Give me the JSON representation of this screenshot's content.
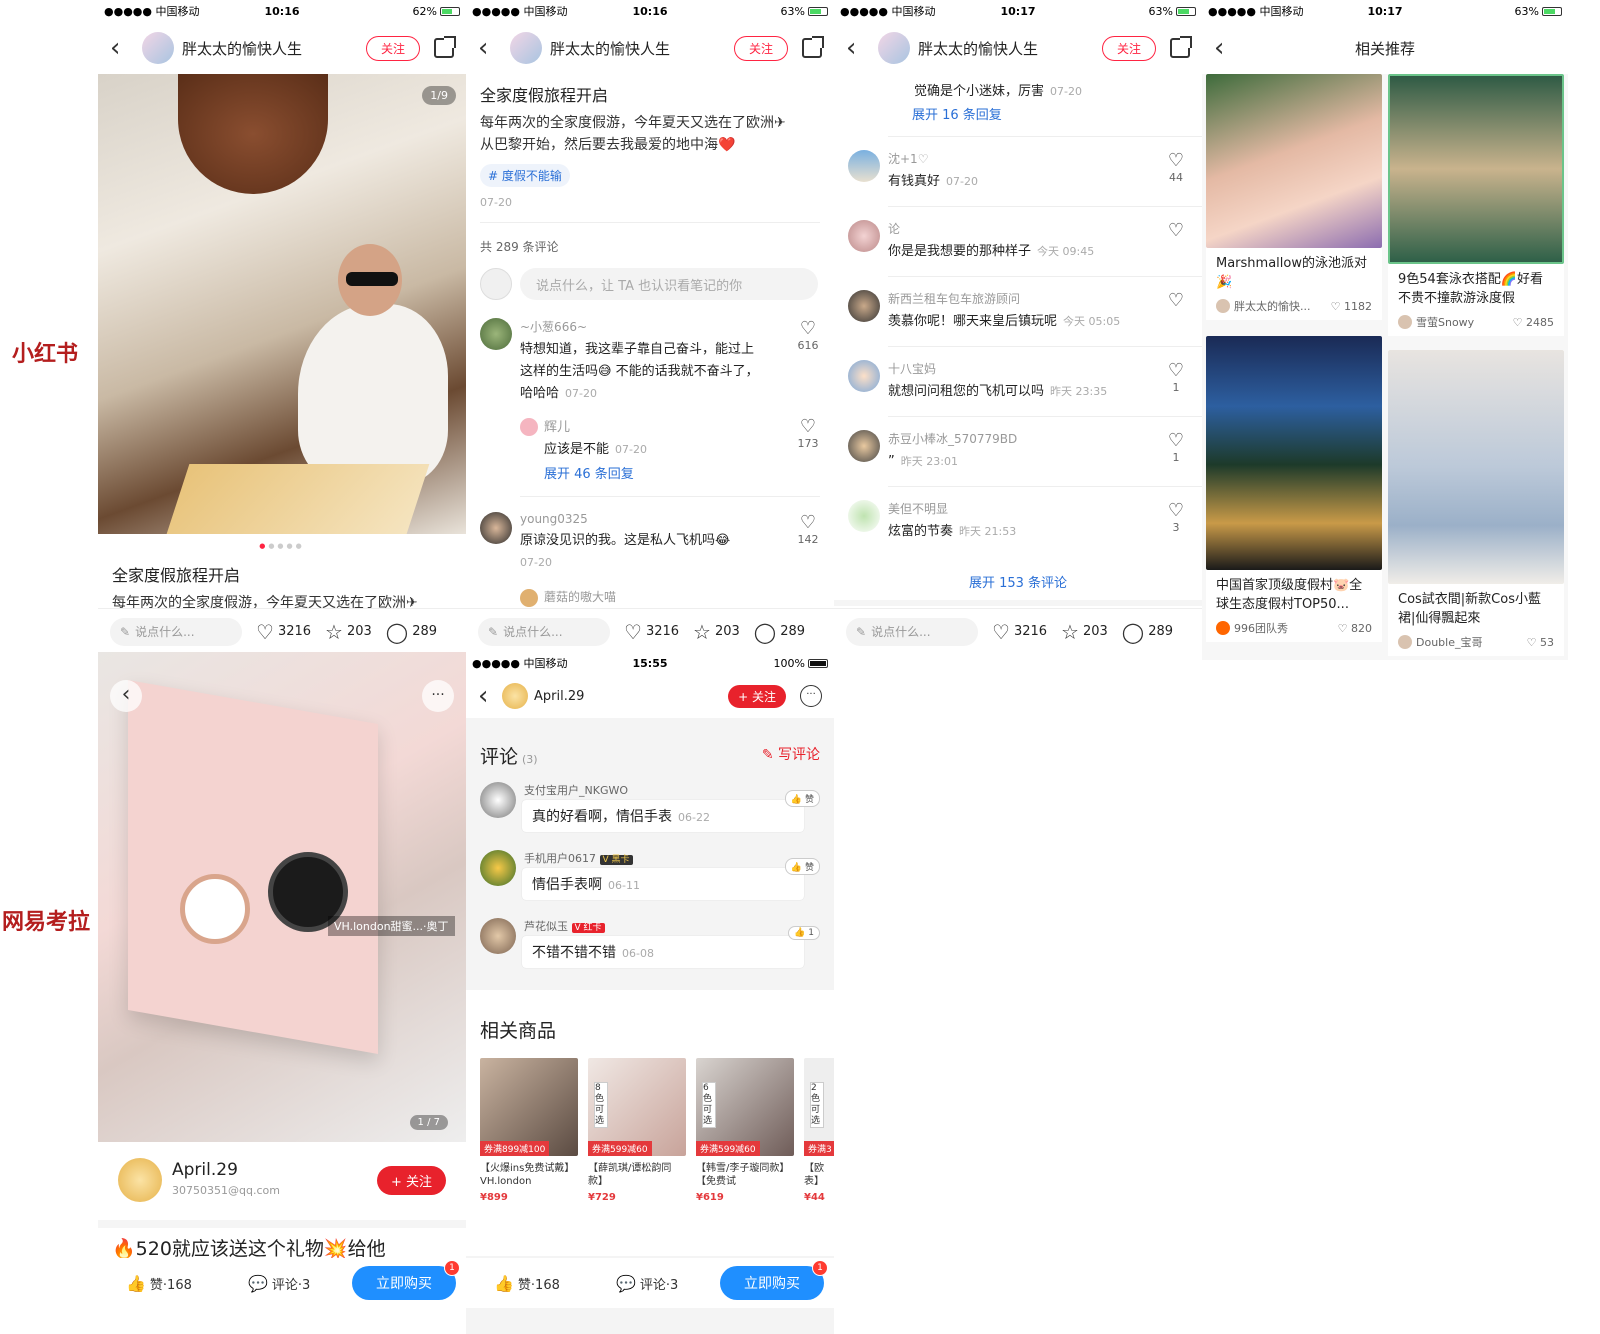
{
  "labels": {
    "xhs": "小红书",
    "kaola": "网易考拉"
  },
  "status": [
    {
      "carrier": "●●●●● 中国移动",
      "time": "10:16",
      "battery": "62%"
    },
    {
      "carrier": "●●●●● 中国移动",
      "time": "10:16",
      "battery": "63%"
    },
    {
      "carrier": "●●●●● 中国移动",
      "time": "10:17",
      "battery": "63%"
    },
    {
      "carrier": "●●●●● 中国移动",
      "time": "10:17",
      "battery": "63%"
    },
    {
      "carrier": "●●●●● 中国移动",
      "time": "15:55",
      "battery": "100%"
    }
  ],
  "xhs": {
    "author": "胖太太的愉快人生",
    "follow": "关注",
    "page_counter": "1/9",
    "title": "全家度假旅程开启",
    "desc": "每年两次的全家度假游，今年夏天又选在了欧洲✈",
    "desc2": "从巴黎开始，然后要去我最爱的地中海❤️",
    "tag": "# 度假不能输",
    "post_date": "07-20",
    "comment_total": "共 289 条评论",
    "comment_placeholder": "说点什么，让 TA 也认识看笔记的你",
    "bar": {
      "input": "说点什么...",
      "likes": "3216",
      "stars": "203",
      "comments": "289"
    },
    "comments_a": [
      {
        "name": "~小葱666~",
        "text": "特想知道，我这辈子靠自己奋斗，能过上",
        "text2": "这样的生活吗😅 不能的话我就不奋斗了，",
        "text3": "哈哈哈",
        "date": "07-20",
        "likes": "616"
      },
      {
        "name": "辉儿",
        "text": "应该是不能",
        "date": "07-20",
        "likes": "173",
        "expand": "展开 46 条回复"
      },
      {
        "name": "young0325",
        "text": "原谅没见识的我。这是私人飞机吗😂",
        "date": "07-20",
        "likes": "142"
      },
      {
        "name": "蘑菇的嗷大喵"
      }
    ],
    "comments_b": [
      {
        "text": "觉确是个小迷妹，厉害",
        "date": "07-20",
        "expand": "展开 16 条回复"
      },
      {
        "name": "沈+1♡",
        "text": "有钱真好",
        "date": "07-20",
        "likes": "44"
      },
      {
        "name": "论",
        "text": "你是是我想要的那种样子",
        "date": "今天 09:45",
        "likes": ""
      },
      {
        "name": "新西兰租车包车旅游顾问",
        "text": "羡慕你呢！哪天来皇后镇玩呢",
        "date": "今天 05:05",
        "likes": ""
      },
      {
        "name": "十八宝妈",
        "text": "就想问问租您的飞机可以吗",
        "date": "昨天 23:35",
        "likes": "1"
      },
      {
        "name": "赤豆小棒冰_570779BD",
        "text": "”",
        "date": "昨天 23:01",
        "likes": "1"
      },
      {
        "name": "美但不明显",
        "text": "炫富的节奏",
        "date": "昨天 21:53",
        "likes": "3"
      }
    ],
    "expand_all": "展开 153 条评论",
    "related_title": "相关推荐",
    "related": [
      {
        "title": "Marshmallow的泳池派对🎉",
        "user": "胖太太的愉快...",
        "likes": "1182"
      },
      {
        "title": "9色54套泳衣搭配🌈好看不贵不撞款游泳度假",
        "user": "雪萤Snowy",
        "likes": "2485"
      },
      {
        "title": "中国首家顶级度假村🐷全球生态度假村TOP50...",
        "user": "996团队秀",
        "likes": "820"
      },
      {
        "title": "Cos試衣間|新款Cos小藍裙|仙得飄起來",
        "user": "Double_宝哥",
        "likes": "53"
      }
    ]
  },
  "kaola": {
    "overlay_tag": "VH.london甜蜜...·奥丁",
    "counter": "1 / 7",
    "user": "April.29",
    "email": "30750351@qq.com",
    "follow": "+ 关注",
    "title": "🔥520就应该送这个礼物💥给他",
    "nav_user": "April.29",
    "comments_title": "评论",
    "comments_count": "(3)",
    "write": "写评论",
    "comments": [
      {
        "name": "支付宝用户_NKGWO",
        "badge": "",
        "text": "真的好看啊，情侣手表",
        "date": "06-22",
        "zan": "赞"
      },
      {
        "name": "手机用户0617",
        "badge": "V 黑卡",
        "text": "情侣手表啊",
        "date": "06-11",
        "zan": "赞"
      },
      {
        "name": "芦花似玉",
        "badge": "V 红卡",
        "text": "不错不错不错",
        "date": "06-08",
        "zan": "1"
      }
    ],
    "goods_title": "相关商品",
    "goods": [
      {
        "coupon": "券满899减100",
        "title": "【火爆ins免费试戴】VH.london",
        "price": "¥899",
        "side": ""
      },
      {
        "coupon": "券满599减60",
        "title": "【薛凯琪/谭松韵同款】",
        "price": "¥729",
        "side": "8色可选"
      },
      {
        "coupon": "券满599减60",
        "title": "【韩雪/李子璇同款】【免费试",
        "price": "¥619",
        "side": "6色可选"
      },
      {
        "coupon": "券满3",
        "title": "【欧表】",
        "price": "¥44",
        "side": "2色可选"
      }
    ],
    "bar": {
      "like": "赞·168",
      "comment": "评论·3",
      "buy": "立即购买",
      "badge": "1"
    }
  }
}
